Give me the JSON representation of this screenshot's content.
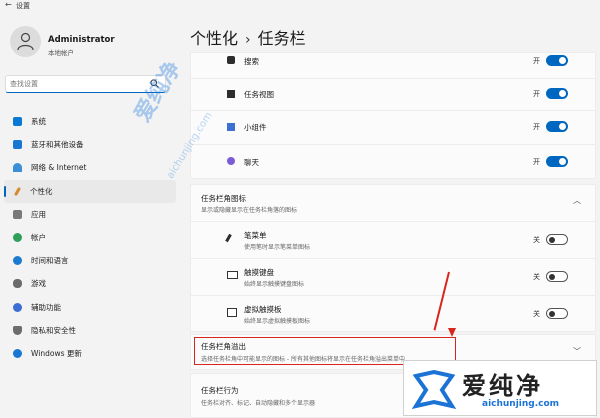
{
  "window": {
    "title": "设置",
    "back": "←"
  },
  "account": {
    "name": "Administrator",
    "type": "本地帐户"
  },
  "search": {
    "placeholder": "查找设置"
  },
  "nav": [
    {
      "label": "系统",
      "color": "#0a78d4"
    },
    {
      "label": "蓝牙和其他设备",
      "color": "#1877d1"
    },
    {
      "label": "网络 & Internet",
      "color": "#3a8fd6"
    },
    {
      "label": "个性化",
      "color": "#d78a2c"
    },
    {
      "label": "应用",
      "color": "#7a7a7a"
    },
    {
      "label": "帐户",
      "color": "#2fa05c"
    },
    {
      "label": "时间和语言",
      "color": "#1c7bd1"
    },
    {
      "label": "游戏",
      "color": "#6b6b6b"
    },
    {
      "label": "辅助功能",
      "color": "#3b6fd4"
    },
    {
      "label": "隐私和安全性",
      "color": "#6d6d6d"
    },
    {
      "label": "Windows 更新",
      "color": "#1877d1"
    }
  ],
  "breadcrumb": {
    "parent": "个性化",
    "sep": "›",
    "current": "任务栏"
  },
  "taskbar_items": [
    {
      "label": "搜索",
      "state": "开"
    },
    {
      "label": "任务视图",
      "state": "开"
    },
    {
      "label": "小组件",
      "state": "开"
    },
    {
      "label": "聊天",
      "state": "开"
    }
  ],
  "corner_icons": {
    "title": "任务栏角图标",
    "subtitle": "显示或隐藏显示在任务栏角落的图标",
    "items": [
      {
        "label": "笔菜单",
        "sub": "使用笔时显示笔菜单图标",
        "state": "关"
      },
      {
        "label": "触摸键盘",
        "sub": "始终显示触摸键盘图标",
        "state": "关"
      },
      {
        "label": "虚拟触摸板",
        "sub": "始终显示虚拟触摸板图标",
        "state": "关"
      }
    ]
  },
  "overflow": {
    "title": "任务栏角溢出",
    "subtitle": "选择任务栏角中可能显示的图标 - 所有其他图标将显示在任务栏角溢出菜单中"
  },
  "behaviors": {
    "title": "任务栏行为",
    "subtitle": "任务栏对齐、标记、自动隐藏和多个显示器"
  },
  "watermark": {
    "text": "爱纯净",
    "url": "aichunjing.com"
  },
  "logo": {
    "text": "爱纯净",
    "url": "aichunjing.com"
  },
  "colors": {
    "accent": "#0067c0",
    "highlight": "#d9261c"
  }
}
